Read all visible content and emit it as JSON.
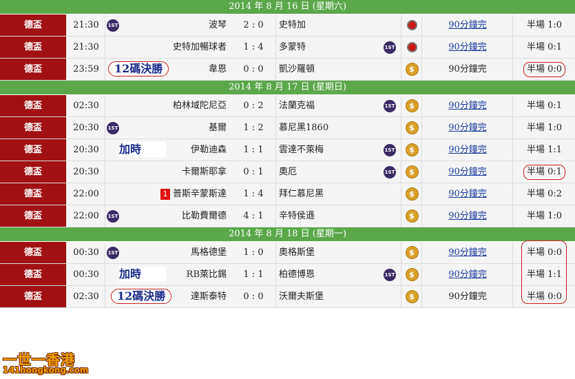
{
  "colors": {
    "league_bg": "#a11112",
    "day_header_bg": "#5aa84a",
    "link": "#1a3aa0",
    "highlight_ring": "#c82020",
    "tag_text": "#1a2a8a"
  },
  "days": [
    {
      "label": "2014 年 8 月 16 日 (星期六)",
      "matches": [
        {
          "league": "德盃",
          "time": "21:30",
          "home": "波琴",
          "score": "2 : 0",
          "away": "史特加",
          "home_badge": "1ST",
          "away_badge": "",
          "icon": "red-dot-icon",
          "status": "90分鐘完",
          "status_link": true,
          "half": "半場 1:0",
          "tag": "",
          "red_card": ""
        },
        {
          "league": "德盃",
          "time": "21:30",
          "home": "史特加暢球者",
          "score": "1 : 4",
          "away": "多蒙特",
          "home_badge": "",
          "away_badge": "1ST",
          "icon": "red-dot-icon",
          "status": "90分鐘完",
          "status_link": true,
          "half": "半場 0:1",
          "tag": "",
          "red_card": ""
        },
        {
          "league": "德盃",
          "time": "23:59",
          "home": "韋恩",
          "score": "0 : 0",
          "away": "凱沙羅頓",
          "home_badge": "",
          "away_badge": "",
          "icon": "dollar-icon",
          "status": "90分鐘完",
          "status_link": false,
          "half": "半場 0:0",
          "tag": "12碼決勝",
          "red_card": ""
        }
      ]
    },
    {
      "label": "2014 年 8 月 17 日 (星期日)",
      "matches": [
        {
          "league": "德盃",
          "time": "02:30",
          "home": "柏林域陀尼亞",
          "score": "0 : 2",
          "away": "法蘭克福",
          "home_badge": "",
          "away_badge": "1ST",
          "icon": "dollar-icon",
          "status": "90分鐘完",
          "status_link": true,
          "half": "半場 0:1",
          "tag": "",
          "red_card": ""
        },
        {
          "league": "德盃",
          "time": "20:30",
          "home": "基爾",
          "score": "1 : 2",
          "away": "慕尼黑1860",
          "home_badge": "1ST",
          "away_badge": "",
          "icon": "dollar-icon",
          "status": "90分鐘完",
          "status_link": true,
          "half": "半場 1:0",
          "tag": "",
          "red_card": ""
        },
        {
          "league": "德盃",
          "time": "20:30",
          "home": "伊勒迪森",
          "score": "1 : 1",
          "away": "雲達不萊梅",
          "home_badge": "",
          "away_badge": "1ST",
          "icon": "dollar-icon",
          "status": "90分鐘完",
          "status_link": true,
          "half": "半場 1:1",
          "tag": "加時",
          "red_card": ""
        },
        {
          "league": "德盃",
          "time": "20:30",
          "home": "卡爾斯耶拿",
          "score": "0 : 1",
          "away": "奧厄",
          "home_badge": "",
          "away_badge": "1ST",
          "icon": "dollar-icon",
          "status": "90分鐘完",
          "status_link": true,
          "half": "半場 0:1",
          "tag": "",
          "red_card": ""
        },
        {
          "league": "德盃",
          "time": "22:00",
          "home": "普斯辛蒙斯達",
          "score": "1 : 4",
          "away": "拜仁慕尼黑",
          "home_badge": "",
          "away_badge": "",
          "icon": "dollar-icon",
          "status": "90分鐘完",
          "status_link": true,
          "half": "半場 0:2",
          "tag": "",
          "red_card": "1"
        },
        {
          "league": "德盃",
          "time": "22:00",
          "home": "比勒費爾德",
          "score": "4 : 1",
          "away": "辛特侯遜",
          "home_badge": "1ST",
          "away_badge": "",
          "icon": "dollar-icon",
          "status": "90分鐘完",
          "status_link": true,
          "half": "半場 1:0",
          "tag": "",
          "red_card": ""
        }
      ]
    },
    {
      "label": "2014 年 8 月 18 日 (星期一)",
      "matches": [
        {
          "league": "德盃",
          "time": "00:30",
          "home": "馬格德堡",
          "score": "1 : 0",
          "away": "奧格斯堡",
          "home_badge": "1ST",
          "away_badge": "",
          "icon": "dollar-icon",
          "status": "90分鐘完",
          "status_link": true,
          "half": "半場 0:0",
          "tag": "",
          "red_card": ""
        },
        {
          "league": "德盃",
          "time": "00:30",
          "home": "RB萊比錫",
          "score": "1 : 1",
          "away": "柏德博恩",
          "home_badge": "",
          "away_badge": "1ST",
          "icon": "dollar-icon",
          "status": "90分鐘完",
          "status_link": true,
          "half": "半場 1:1",
          "tag": "加時",
          "red_card": ""
        },
        {
          "league": "德盃",
          "time": "02:30",
          "home": "達斯泰特",
          "score": "0 : 0",
          "away": "沃爾夫斯堡",
          "home_badge": "",
          "away_badge": "",
          "icon": "dollar-icon",
          "status": "90分鐘完",
          "status_link": false,
          "half": "半場 0:0",
          "tag": "12碼決勝",
          "red_card": ""
        }
      ]
    }
  ],
  "logo": {
    "main": "一世一香港",
    "sub": "141hongkong.com"
  }
}
